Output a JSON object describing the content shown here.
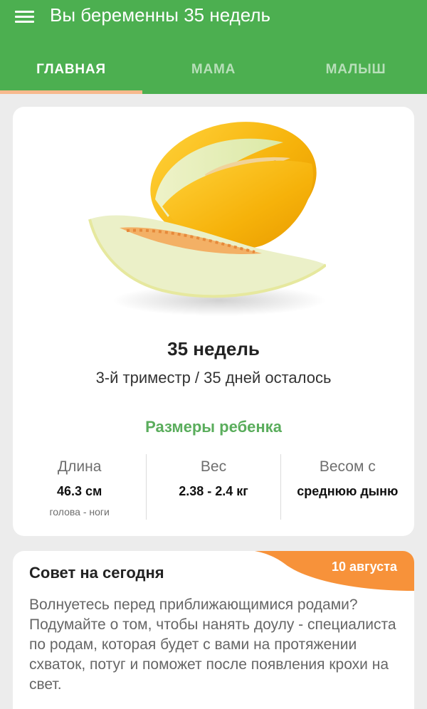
{
  "app": {
    "title": "Вы беременны 35 недель",
    "primary_color": "#4caf50",
    "accent_color": "#f7b98d"
  },
  "tabs": [
    {
      "label": "ГЛАВНАЯ",
      "active": true
    },
    {
      "label": "МАМА",
      "active": false
    },
    {
      "label": "МАЛЫШ",
      "active": false
    }
  ],
  "pregnancy": {
    "fruit_image": "honeydew-melon",
    "week_label": "35 недель",
    "trimester_text": "3-й триместр / 35 дней осталось",
    "sizes_title": "Размеры ребенка",
    "metrics": [
      {
        "label": "Длина",
        "value": "46.3 см",
        "note": "голова - ноги"
      },
      {
        "label": "Вес",
        "value": "2.38 - 2.4 кг",
        "note": ""
      },
      {
        "label": "Весом с",
        "value": "среднюю дыню",
        "note": ""
      }
    ]
  },
  "tip": {
    "title": "Совет на сегодня",
    "date": "10 августа",
    "badge_color": "#f7923a",
    "text": "Волнуетесь перед приближающимися родами? Подумайте о том, чтобы нанять доулу - специалиста по родам, которая будет с вами на протяжении схваток, потуг и поможет после появления крохи на свет."
  }
}
